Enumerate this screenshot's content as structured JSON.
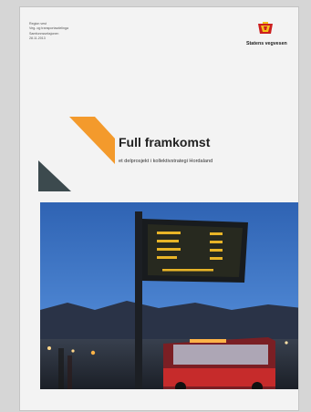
{
  "document": {
    "meta_lines": [
      "Region vest",
      "Veg- og transportavdelinga",
      "Samfunnsseksjonen",
      "28.11.2013"
    ],
    "logo_text": "Statens vegvesen",
    "title": "Full framkomst",
    "subtitle": "et delprosjekt i kollektivstrategi Hordaland"
  },
  "colors": {
    "brand_orange": "#f39a2c",
    "dark_slate": "#3c4a4e",
    "logo_red": "#cc1f1f",
    "logo_yellow": "#f3c11b"
  },
  "photo": {
    "subject": "bus-stop-display-photo"
  }
}
